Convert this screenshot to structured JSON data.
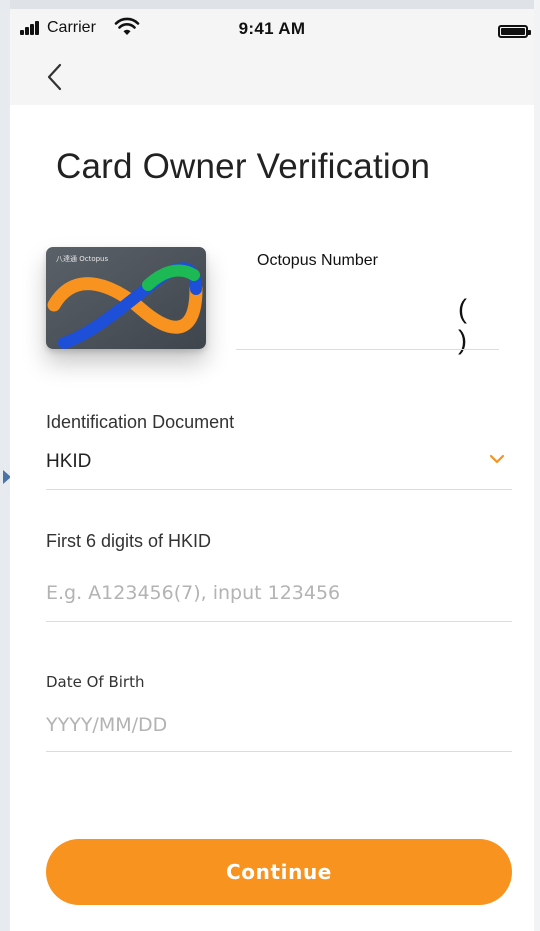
{
  "status_bar": {
    "carrier": "Carrier",
    "time": "9:41 AM",
    "icons": [
      "signal-icon",
      "wifi-icon",
      "battery-icon"
    ]
  },
  "nav": {
    "back_icon": "chevron-left-icon"
  },
  "page": {
    "title": "Card Owner Verification"
  },
  "card": {
    "image_text": "八達通 Octopus",
    "number_label": "Octopus Number",
    "number_value": "( )"
  },
  "id_document": {
    "label": "Identification Document",
    "selected": "HKID",
    "icon": "chevron-down-icon"
  },
  "hkid": {
    "label": "First 6 digits of HKID",
    "value": "",
    "placeholder": "E.g. A123456(7), input 123456"
  },
  "dob": {
    "label": "Date Of Birth",
    "value": "",
    "placeholder": "YYYY/MM/DD"
  },
  "actions": {
    "continue_label": "Continue"
  },
  "colors": {
    "accent": "#f7931e",
    "header_bg": "#f5f5f5",
    "card_bg": "#4a5058",
    "octopus_green": "#1db954",
    "octopus_blue": "#1e4fd8",
    "octopus_orange": "#f7931e"
  }
}
